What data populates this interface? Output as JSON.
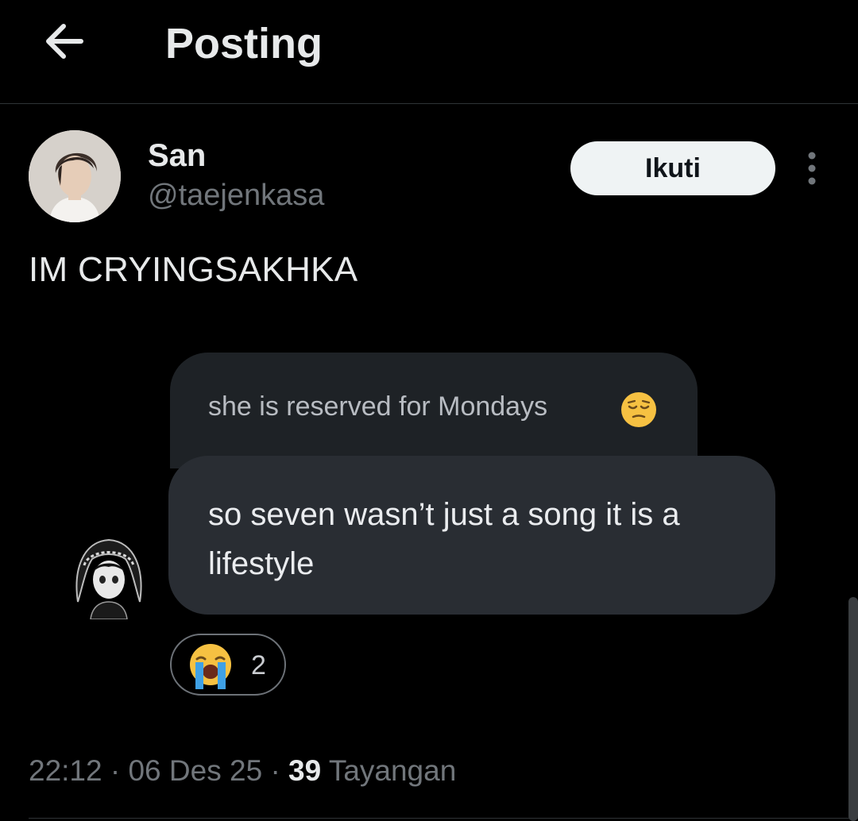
{
  "header": {
    "title": "Posting",
    "back_icon": "arrow-left-icon"
  },
  "post": {
    "author": {
      "name": "San",
      "handle": "@taejenkasa"
    },
    "follow_label": "Ikuti",
    "more_icon": "more-vertical-icon",
    "text": "IM CRYINGSAKHKA",
    "embedded_chat": {
      "top_message": "she is reserved for Mondays",
      "top_message_emoji": "relieved-face-emoji",
      "main_message": "so seven wasn’t just a song it is a lifestyle",
      "reaction_emoji": "loudly-crying-face-emoji",
      "reaction_count": "2"
    },
    "meta": {
      "time": "22:12",
      "separator": "·",
      "date": "06 Des 25",
      "views_count": "39",
      "views_label": "Tayangan"
    }
  },
  "colors": {
    "background": "#000000",
    "primary_text": "#e7e9ea",
    "secondary_text": "#71767b",
    "follow_button_bg": "#eff3f4",
    "chat_bubble_main": "#292d33",
    "chat_bubble_top": "#1e2226"
  }
}
